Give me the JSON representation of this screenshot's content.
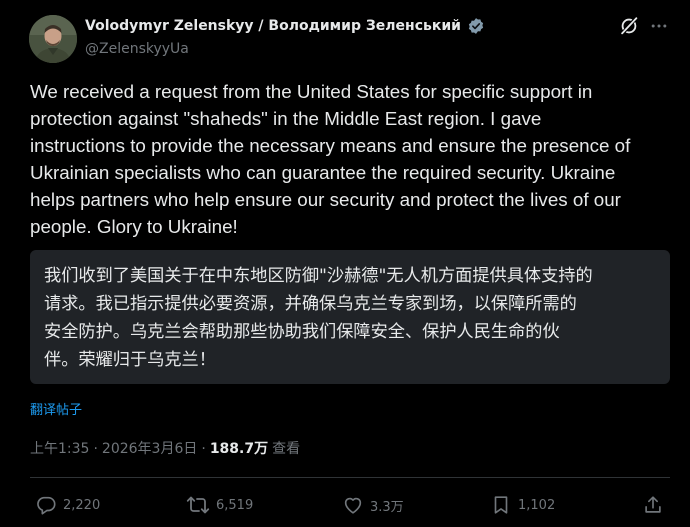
{
  "author": {
    "display_name": "Volodymyr Zelenskyy / Володимир Зеленський",
    "handle": "@ZelenskyyUa"
  },
  "post": {
    "text": "We received a request from the United States for specific support in\nprotection against \"shaheds\" in the Middle East region. I gave\ninstructions to provide the necessary means and ensure the presence of\nUkrainian specialists who can guarantee the required security. Ukraine\nhelps partners who help ensure our security and protect the lives of our\npeople. Glory to Ukraine!",
    "translation": "我们收到了美国关于在中东地区防御\"沙赫德\"无人机方面提供具体支持的\n请求。我已指示提供必要资源，并确保乌克兰专家到场，以保障所需的\n安全防护。乌克兰会帮助那些协助我们保障安全、保护人民生命的伙\n伴。荣耀归于乌克兰！",
    "translate_link": "翻译帖子",
    "time": "上午1:35",
    "separator": "·",
    "date": "2026年3月6日",
    "views_count": "188.7万",
    "views_label": "查看"
  },
  "actions": {
    "replies": "2,220",
    "reposts": "6,519",
    "likes": "3.3万",
    "bookmarks": "1,102"
  },
  "colors": {
    "background": "#000000",
    "text": "#e7e9ea",
    "muted": "#71767b",
    "accent": "#1d9bf0",
    "translation_bg": "#202327"
  },
  "icons": [
    "verified-badge-icon",
    "grok-icon",
    "more-icon",
    "reply-icon",
    "repost-icon",
    "like-icon",
    "bookmark-icon",
    "share-icon"
  ]
}
